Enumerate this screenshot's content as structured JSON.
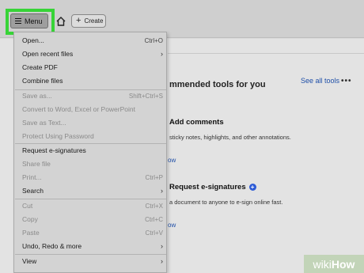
{
  "toolbar": {
    "menu_label": "Menu",
    "create_label": "Create"
  },
  "menu": {
    "items": [
      {
        "label": "Open...",
        "shortcut": "Ctrl+O"
      },
      {
        "label": "Open recent files",
        "shortcut": ""
      },
      {
        "label": "Create PDF",
        "shortcut": ""
      },
      {
        "label": "Combine files",
        "shortcut": ""
      },
      {
        "label": "Save as...",
        "shortcut": "Shift+Ctrl+S"
      },
      {
        "label": "Convert to Word, Excel or PowerPoint",
        "shortcut": ""
      },
      {
        "label": "Save as Text...",
        "shortcut": ""
      },
      {
        "label": "Protect Using Password",
        "shortcut": ""
      },
      {
        "label": "Request e-signatures",
        "shortcut": ""
      },
      {
        "label": "Share file",
        "shortcut": ""
      },
      {
        "label": "Print...",
        "shortcut": "Ctrl+P"
      },
      {
        "label": "Search",
        "shortcut": ""
      },
      {
        "label": "Cut",
        "shortcut": "Ctrl+X"
      },
      {
        "label": "Copy",
        "shortcut": "Ctrl+C"
      },
      {
        "label": "Paste",
        "shortcut": "Ctrl+V"
      },
      {
        "label": "Undo, Redo & more",
        "shortcut": ""
      },
      {
        "label": "View",
        "shortcut": ""
      }
    ]
  },
  "main": {
    "recommended_title": "mmended tools for you",
    "see_all": "See all tools",
    "more": "•••",
    "tools": [
      {
        "title": "Add comments",
        "desc": "sticky notes, highlights, and other annotations.",
        "link": "ow"
      },
      {
        "title": "Request e-signatures",
        "desc": "a document to anyone to e-sign online fast.",
        "link": "ow"
      }
    ]
  },
  "watermark": {
    "part1": "wiki",
    "part2": "How"
  },
  "colors": {
    "highlight": "#37d437",
    "link": "#1f4fa8"
  }
}
